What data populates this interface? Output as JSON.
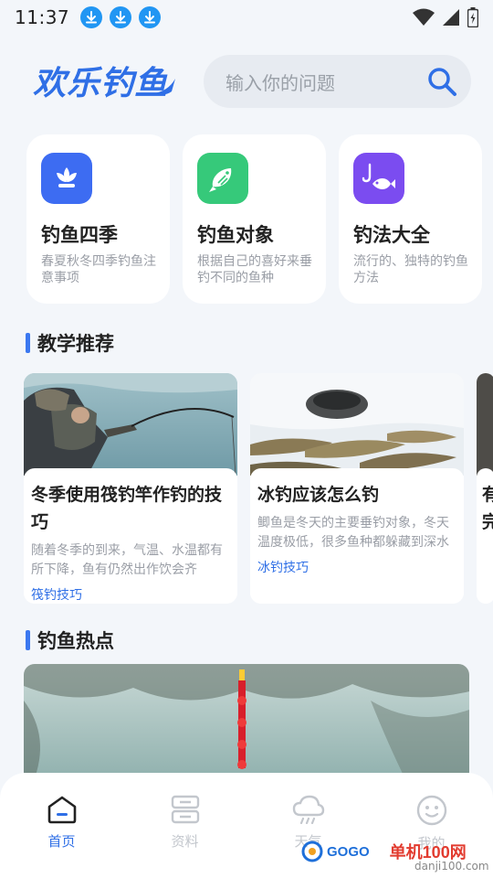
{
  "status_bar": {
    "time": "11:37",
    "download_icon_count": 3
  },
  "header": {
    "logo_text": "欢乐钓鱼",
    "search_placeholder": "输入你的问题"
  },
  "categories": [
    {
      "title": "钓鱼四季",
      "desc": "春夏秋冬四季钓鱼注意事项",
      "icon": "flower-icon",
      "color": "#3d6cf2"
    },
    {
      "title": "钓鱼对象",
      "desc": "根据自己的喜好来垂钓不同的鱼种",
      "icon": "fish-icon",
      "color": "#36c97a"
    },
    {
      "title": "钓法大全",
      "desc": "流行的、独特的钓鱼方法",
      "icon": "fishhook-icon",
      "color": "#7b4cf0"
    }
  ],
  "sections": {
    "teaching": "教学推荐",
    "hot": "钓鱼热点"
  },
  "articles": [
    {
      "title": "冬季使用筏钓竿作钓的技巧",
      "desc": "随着冬季的到来，气温、水温都有所下降，鱼有仍然出作饮会齐",
      "tag": "筏钓技巧"
    },
    {
      "title": "冰钓应该怎么钓",
      "desc": "鲫鱼是冬天的主要垂钓对象，冬天温度极低，很多鱼种都躲藏到深水不再游动进食，由于鲫鱼耐",
      "tag": "冰钓技巧"
    },
    {
      "title": "有完",
      "desc": "",
      "tag": ""
    }
  ],
  "bottom_nav": [
    {
      "label": "首页",
      "icon": "home-icon",
      "active": true
    },
    {
      "label": "资料",
      "icon": "data-icon",
      "active": false
    },
    {
      "label": "天气",
      "icon": "weather-icon",
      "active": false
    },
    {
      "label": "我的",
      "icon": "profile-icon",
      "active": false
    }
  ],
  "watermark": {
    "brand": "GOGO",
    "site": "单机100网",
    "url": "danji100.com"
  },
  "colors": {
    "accent": "#2f6fe6",
    "background": "#f3f6fa"
  }
}
